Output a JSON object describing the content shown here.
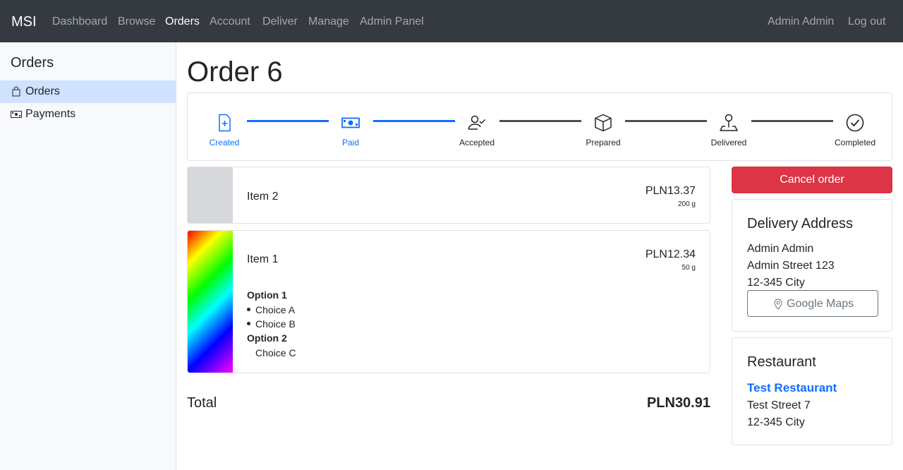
{
  "navbar": {
    "brand": "MSI",
    "links": [
      "Dashboard",
      "Browse",
      "Orders",
      "Account",
      "Deliver",
      "Manage",
      "Admin Panel"
    ],
    "active_link": "Orders",
    "user_name": "Admin Admin",
    "logout_label": "Log out"
  },
  "sidebar": {
    "title": "Orders",
    "items": [
      {
        "label": "Orders",
        "icon": "bag-icon",
        "active": true
      },
      {
        "label": "Payments",
        "icon": "cash-icon",
        "active": false
      }
    ]
  },
  "order": {
    "title": "Order 6",
    "steps": [
      {
        "label": "Created",
        "icon": "file-plus-icon",
        "done": true
      },
      {
        "label": "Paid",
        "icon": "cash-icon",
        "done": true
      },
      {
        "label": "Accepted",
        "icon": "person-check-icon",
        "done": false
      },
      {
        "label": "Prepared",
        "icon": "box-icon",
        "done": false
      },
      {
        "label": "Delivered",
        "icon": "person-pin-icon",
        "done": false
      },
      {
        "label": "Completed",
        "icon": "check-circle-icon",
        "done": false
      }
    ],
    "progress_fraction": 0.2,
    "items": [
      {
        "name": "Item 2",
        "price": "PLN13.37",
        "weight": "200 g"
      },
      {
        "name": "Item 1",
        "price": "PLN12.34",
        "weight": "50 g",
        "options": [
          {
            "title": "Option 1",
            "choices": [
              "Choice A",
              "Choice B"
            ]
          },
          {
            "title": "Option 2",
            "choices": [
              "Choice C"
            ]
          }
        ]
      }
    ],
    "total_label": "Total",
    "total_value": "PLN30.91",
    "cancel_label": "Cancel order"
  },
  "delivery": {
    "title": "Delivery Address",
    "name": "Admin Admin",
    "street": "Admin Street 123",
    "city": "12-345 City",
    "maps_label": "Google Maps"
  },
  "restaurant": {
    "title": "Restaurant",
    "name": "Test Restaurant",
    "street": "Test Street 7",
    "city": "12-345 City"
  },
  "colors": {
    "accent": "#0d6efd",
    "danger": "#dc3545",
    "navbar": "#343a40"
  }
}
